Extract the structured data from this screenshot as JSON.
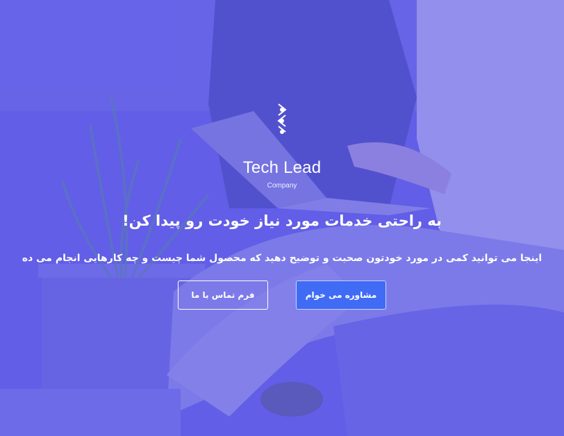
{
  "logo": {
    "icon": "tech-lead-logo-icon",
    "name": "Tech Lead",
    "subtitle": "Company"
  },
  "hero": {
    "headline": "به راحتی خدمات مورد نیاز خودت رو پیدا کن!",
    "description": "اینجا می توانید کمی در مورد خودتون صحبت و توضیح دهید که محصول شما چیست و چه کارهایی انجام می ده"
  },
  "buttons": {
    "primary_label": "مشاوره می خوام",
    "secondary_label": "فرم تماس با ما"
  },
  "colors": {
    "overlay": "#5854e6",
    "primary_button": "#3f6bf5",
    "text": "#ffffff"
  }
}
